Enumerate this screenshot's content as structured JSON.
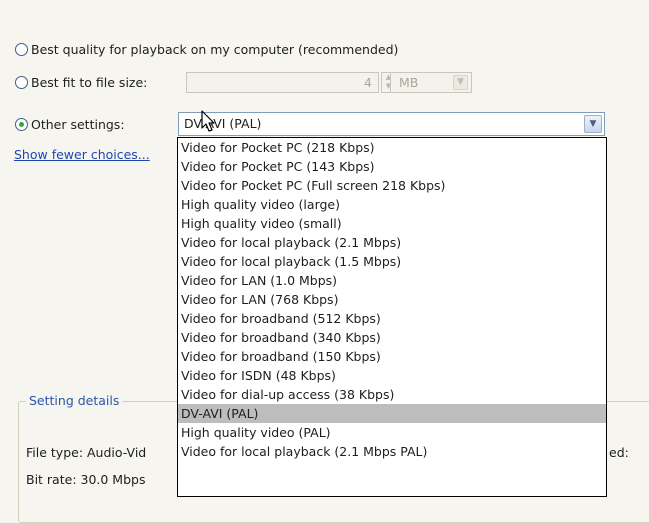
{
  "options": {
    "best_quality": "Best quality for playback on my computer (recommended)",
    "best_fit": "Best fit to file size:",
    "other": "Other settings:"
  },
  "file_size": {
    "value": "4",
    "unit": "MB"
  },
  "other_settings": {
    "selected": "DV-AVI (PAL)"
  },
  "show_fewer": "Show fewer choices...",
  "dropdown_items": [
    "Video for Pocket PC (218 Kbps)",
    "Video for Pocket PC (143 Kbps)",
    "Video for Pocket PC (Full screen 218 Kbps)",
    "High quality video (large)",
    "High quality video (small)",
    "Video for local playback (2.1 Mbps)",
    "Video for local playback (1.5 Mbps)",
    "Video for LAN (1.0 Mbps)",
    "Video for LAN (768 Kbps)",
    "Video for broadband (512 Kbps)",
    "Video for broadband (340 Kbps)",
    "Video for broadband (150 Kbps)",
    "Video for ISDN (48 Kbps)",
    "Video for dial-up access (38 Kbps)",
    "DV-AVI (PAL)",
    "High quality video (PAL)",
    "Video for local playback (2.1 Mbps PAL)"
  ],
  "setting_details": {
    "label": "Setting details",
    "file_type": "File type: Audio-Vid",
    "bit_rate": "Bit rate: 30.0 Mbps",
    "right_fragment": "ed:"
  }
}
